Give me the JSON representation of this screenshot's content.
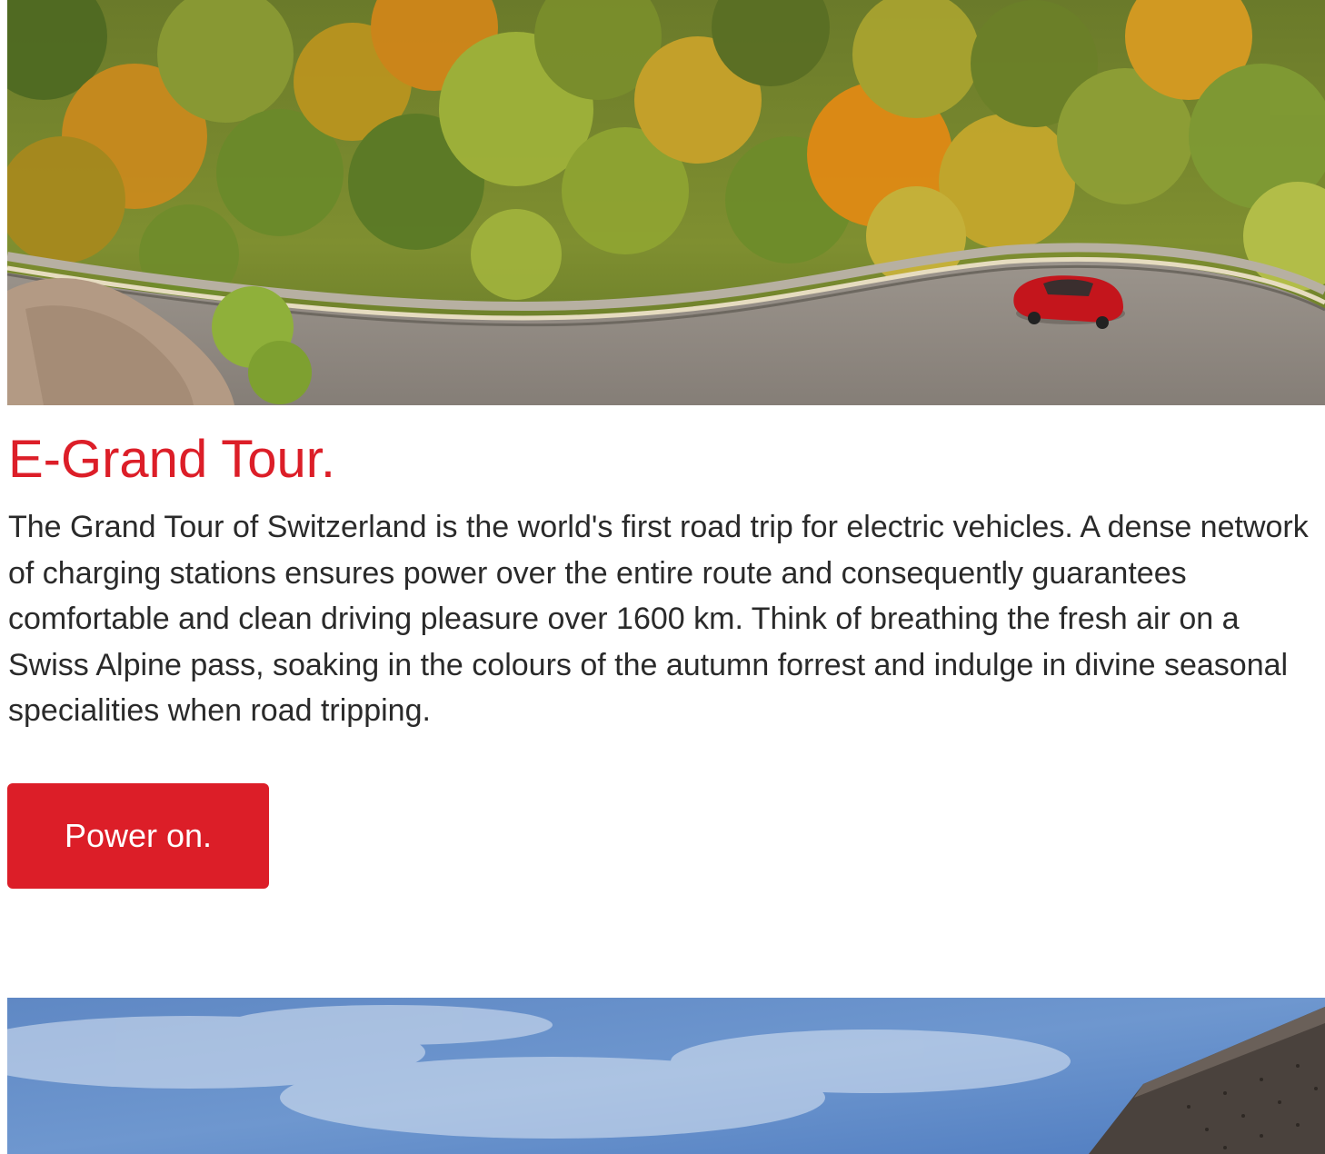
{
  "article": {
    "title": "E-Grand Tour.",
    "body": "The Grand Tour of Switzerland is the world's first road trip for electric vehicles. A dense network of charging stations ensures power over the entire route and consequently guarantees comfortable and clean driving pleasure over 1600 km. Think of breathing the fresh air on a Swiss Alpine pass, soaking in the colours of the autumn forrest and indulge in divine seasonal specialities when road tripping.",
    "cta_label": "Power on."
  },
  "colors": {
    "accent": "#dc1e28",
    "text": "#2a2a2a",
    "background": "#ffffff"
  }
}
